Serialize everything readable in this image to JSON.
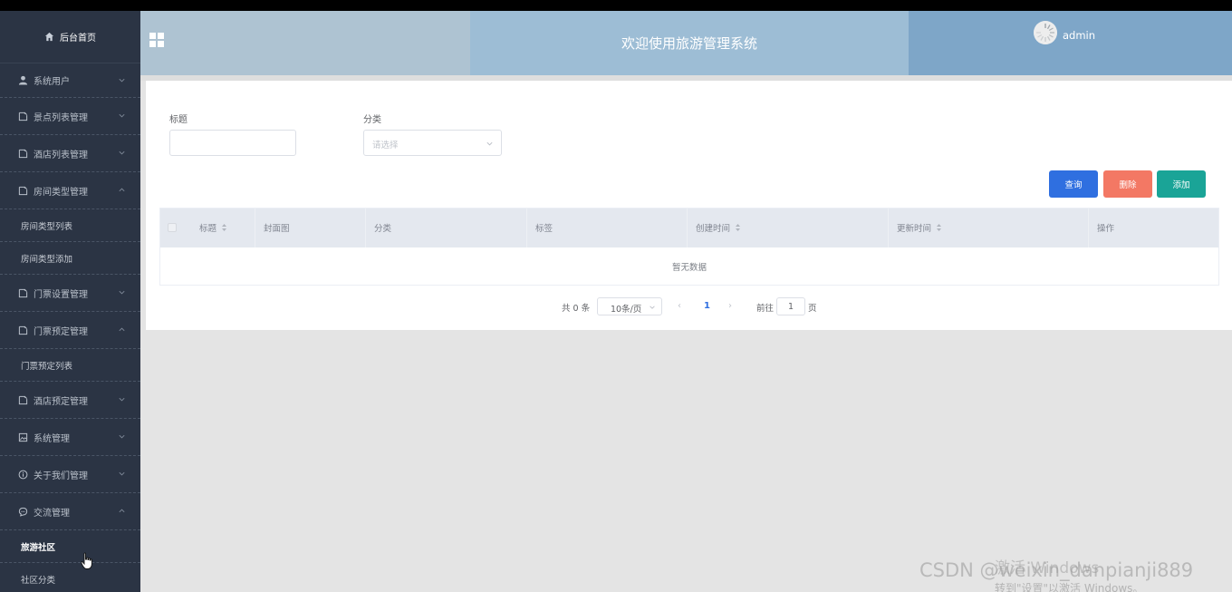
{
  "sidebar": {
    "home": "后台首页",
    "menu": [
      {
        "label": "系统用户",
        "icon": "user-icon",
        "expanded": false
      },
      {
        "label": "景点列表管理",
        "icon": "document-icon",
        "expanded": false
      },
      {
        "label": "酒店列表管理",
        "icon": "document-icon",
        "expanded": false
      },
      {
        "label": "房间类型管理",
        "icon": "document-icon",
        "expanded": true,
        "children": [
          "房间类型列表",
          "房间类型添加"
        ]
      },
      {
        "label": "门票设置管理",
        "icon": "document-icon",
        "expanded": false
      },
      {
        "label": "门票预定管理",
        "icon": "document-icon",
        "expanded": true,
        "children": [
          "门票预定列表"
        ]
      },
      {
        "label": "酒店预定管理",
        "icon": "document-icon",
        "expanded": false
      },
      {
        "label": "系统管理",
        "icon": "picture-icon",
        "expanded": false
      },
      {
        "label": "关于我们管理",
        "icon": "info-icon",
        "expanded": false
      },
      {
        "label": "交流管理",
        "icon": "chat-icon",
        "expanded": true,
        "children": [
          "旅游社区",
          "社区分类"
        ]
      }
    ],
    "active_item": "旅游社区"
  },
  "header": {
    "title": "欢迎使用旅游管理系统",
    "username": "admin"
  },
  "search": {
    "title_label": "标题",
    "title_value": "",
    "category_label": "分类",
    "category_placeholder": "请选择"
  },
  "actions": {
    "query": "查询",
    "delete": "删除",
    "add": "添加"
  },
  "table": {
    "columns": [
      "标题",
      "封面图",
      "分类",
      "标签",
      "创建时间",
      "更新时间",
      "操作"
    ],
    "rows": [],
    "empty_text": "暂无数据"
  },
  "pagination": {
    "total": "共 0 条",
    "page_size": "10条/页",
    "current_page": "1",
    "goto_label": "前往",
    "goto_value": "1",
    "page_suffix": "页"
  },
  "overlay": {
    "csdn": "CSDN @weixin_danpianji889",
    "windows_line1": "激活 Windows",
    "windows_line2": "转到\"设置\"以激活 Windows。"
  },
  "colors": {
    "sidebar_bg": "#2b3444",
    "header_left": "#aec3d2",
    "header_mid": "#9dbdd5",
    "header_right": "#7ea6c8",
    "query_button": "#2f6fe0",
    "delete_button": "#f37864",
    "add_button": "#1aa497"
  }
}
